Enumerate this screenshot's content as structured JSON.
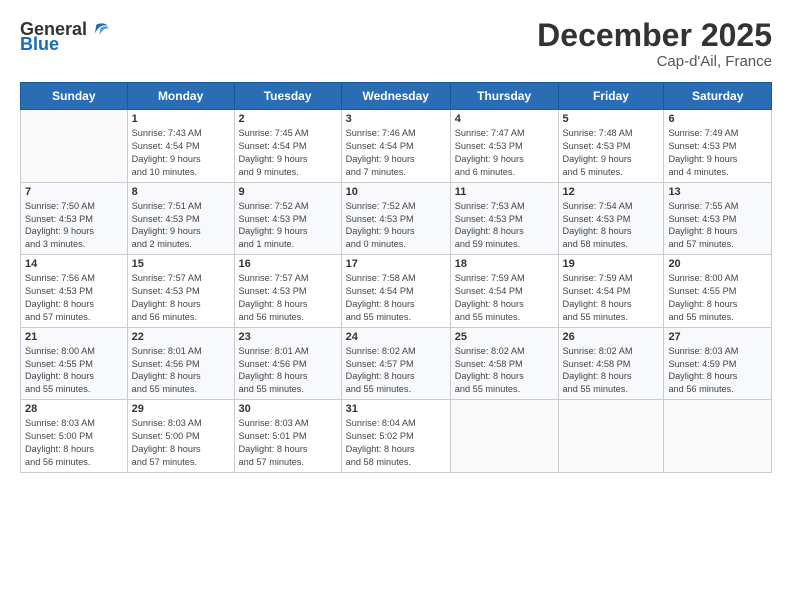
{
  "logo": {
    "general": "General",
    "blue": "Blue"
  },
  "header": {
    "month": "December 2025",
    "location": "Cap-d'Ail, France"
  },
  "weekdays": [
    "Sunday",
    "Monday",
    "Tuesday",
    "Wednesday",
    "Thursday",
    "Friday",
    "Saturday"
  ],
  "weeks": [
    [
      {
        "day": "",
        "info": ""
      },
      {
        "day": "1",
        "info": "Sunrise: 7:43 AM\nSunset: 4:54 PM\nDaylight: 9 hours\nand 10 minutes."
      },
      {
        "day": "2",
        "info": "Sunrise: 7:45 AM\nSunset: 4:54 PM\nDaylight: 9 hours\nand 9 minutes."
      },
      {
        "day": "3",
        "info": "Sunrise: 7:46 AM\nSunset: 4:54 PM\nDaylight: 9 hours\nand 7 minutes."
      },
      {
        "day": "4",
        "info": "Sunrise: 7:47 AM\nSunset: 4:53 PM\nDaylight: 9 hours\nand 6 minutes."
      },
      {
        "day": "5",
        "info": "Sunrise: 7:48 AM\nSunset: 4:53 PM\nDaylight: 9 hours\nand 5 minutes."
      },
      {
        "day": "6",
        "info": "Sunrise: 7:49 AM\nSunset: 4:53 PM\nDaylight: 9 hours\nand 4 minutes."
      }
    ],
    [
      {
        "day": "7",
        "info": "Sunrise: 7:50 AM\nSunset: 4:53 PM\nDaylight: 9 hours\nand 3 minutes."
      },
      {
        "day": "8",
        "info": "Sunrise: 7:51 AM\nSunset: 4:53 PM\nDaylight: 9 hours\nand 2 minutes."
      },
      {
        "day": "9",
        "info": "Sunrise: 7:52 AM\nSunset: 4:53 PM\nDaylight: 9 hours\nand 1 minute."
      },
      {
        "day": "10",
        "info": "Sunrise: 7:52 AM\nSunset: 4:53 PM\nDaylight: 9 hours\nand 0 minutes."
      },
      {
        "day": "11",
        "info": "Sunrise: 7:53 AM\nSunset: 4:53 PM\nDaylight: 8 hours\nand 59 minutes."
      },
      {
        "day": "12",
        "info": "Sunrise: 7:54 AM\nSunset: 4:53 PM\nDaylight: 8 hours\nand 58 minutes."
      },
      {
        "day": "13",
        "info": "Sunrise: 7:55 AM\nSunset: 4:53 PM\nDaylight: 8 hours\nand 57 minutes."
      }
    ],
    [
      {
        "day": "14",
        "info": "Sunrise: 7:56 AM\nSunset: 4:53 PM\nDaylight: 8 hours\nand 57 minutes."
      },
      {
        "day": "15",
        "info": "Sunrise: 7:57 AM\nSunset: 4:53 PM\nDaylight: 8 hours\nand 56 minutes."
      },
      {
        "day": "16",
        "info": "Sunrise: 7:57 AM\nSunset: 4:53 PM\nDaylight: 8 hours\nand 56 minutes."
      },
      {
        "day": "17",
        "info": "Sunrise: 7:58 AM\nSunset: 4:54 PM\nDaylight: 8 hours\nand 55 minutes."
      },
      {
        "day": "18",
        "info": "Sunrise: 7:59 AM\nSunset: 4:54 PM\nDaylight: 8 hours\nand 55 minutes."
      },
      {
        "day": "19",
        "info": "Sunrise: 7:59 AM\nSunset: 4:54 PM\nDaylight: 8 hours\nand 55 minutes."
      },
      {
        "day": "20",
        "info": "Sunrise: 8:00 AM\nSunset: 4:55 PM\nDaylight: 8 hours\nand 55 minutes."
      }
    ],
    [
      {
        "day": "21",
        "info": "Sunrise: 8:00 AM\nSunset: 4:55 PM\nDaylight: 8 hours\nand 55 minutes."
      },
      {
        "day": "22",
        "info": "Sunrise: 8:01 AM\nSunset: 4:56 PM\nDaylight: 8 hours\nand 55 minutes."
      },
      {
        "day": "23",
        "info": "Sunrise: 8:01 AM\nSunset: 4:56 PM\nDaylight: 8 hours\nand 55 minutes."
      },
      {
        "day": "24",
        "info": "Sunrise: 8:02 AM\nSunset: 4:57 PM\nDaylight: 8 hours\nand 55 minutes."
      },
      {
        "day": "25",
        "info": "Sunrise: 8:02 AM\nSunset: 4:58 PM\nDaylight: 8 hours\nand 55 minutes."
      },
      {
        "day": "26",
        "info": "Sunrise: 8:02 AM\nSunset: 4:58 PM\nDaylight: 8 hours\nand 55 minutes."
      },
      {
        "day": "27",
        "info": "Sunrise: 8:03 AM\nSunset: 4:59 PM\nDaylight: 8 hours\nand 56 minutes."
      }
    ],
    [
      {
        "day": "28",
        "info": "Sunrise: 8:03 AM\nSunset: 5:00 PM\nDaylight: 8 hours\nand 56 minutes."
      },
      {
        "day": "29",
        "info": "Sunrise: 8:03 AM\nSunset: 5:00 PM\nDaylight: 8 hours\nand 57 minutes."
      },
      {
        "day": "30",
        "info": "Sunrise: 8:03 AM\nSunset: 5:01 PM\nDaylight: 8 hours\nand 57 minutes."
      },
      {
        "day": "31",
        "info": "Sunrise: 8:04 AM\nSunset: 5:02 PM\nDaylight: 8 hours\nand 58 minutes."
      },
      {
        "day": "",
        "info": ""
      },
      {
        "day": "",
        "info": ""
      },
      {
        "day": "",
        "info": ""
      }
    ]
  ]
}
